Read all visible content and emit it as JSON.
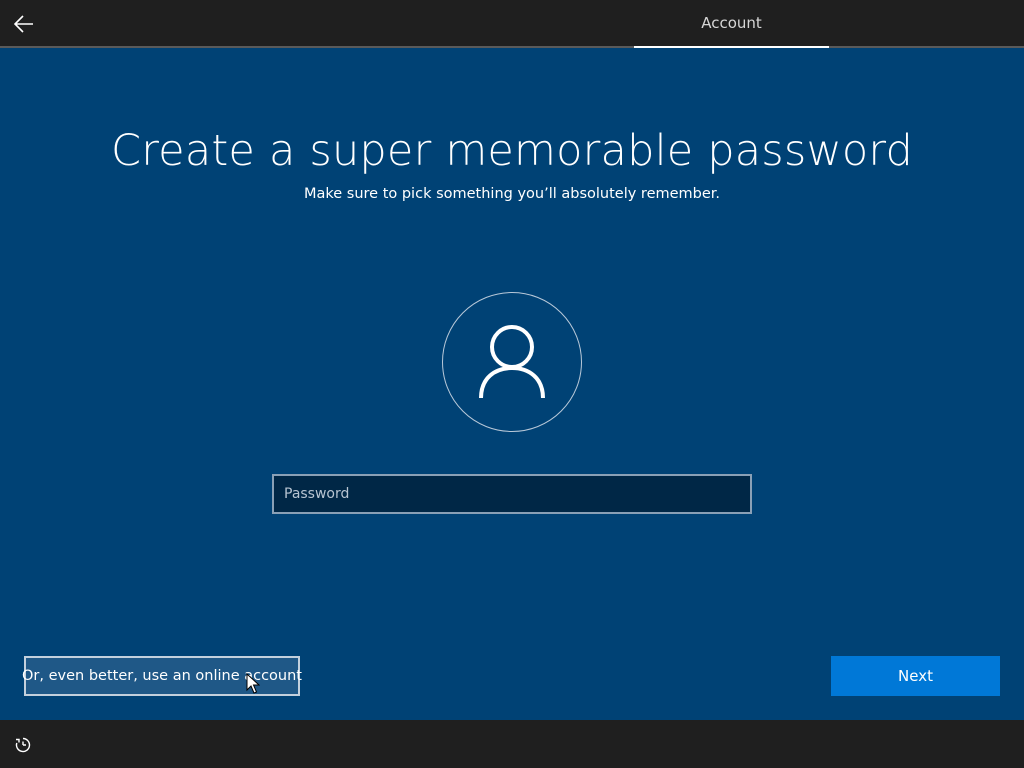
{
  "header": {
    "back_icon": "arrow-left-icon",
    "tab_label": "Account"
  },
  "main": {
    "title": "Create a super memorable password",
    "subtitle": "Make sure to pick something you’ll absolutely remember.",
    "avatar_icon": "user-icon",
    "password_placeholder": "Password",
    "password_value": ""
  },
  "footer": {
    "online_account_label": "Or, even better, use an online account",
    "next_label": "Next",
    "ease_of_access_icon": "ease-of-access-icon"
  },
  "colors": {
    "background": "#004275",
    "bar": "#1f1f1f",
    "accent": "#0078d7"
  }
}
